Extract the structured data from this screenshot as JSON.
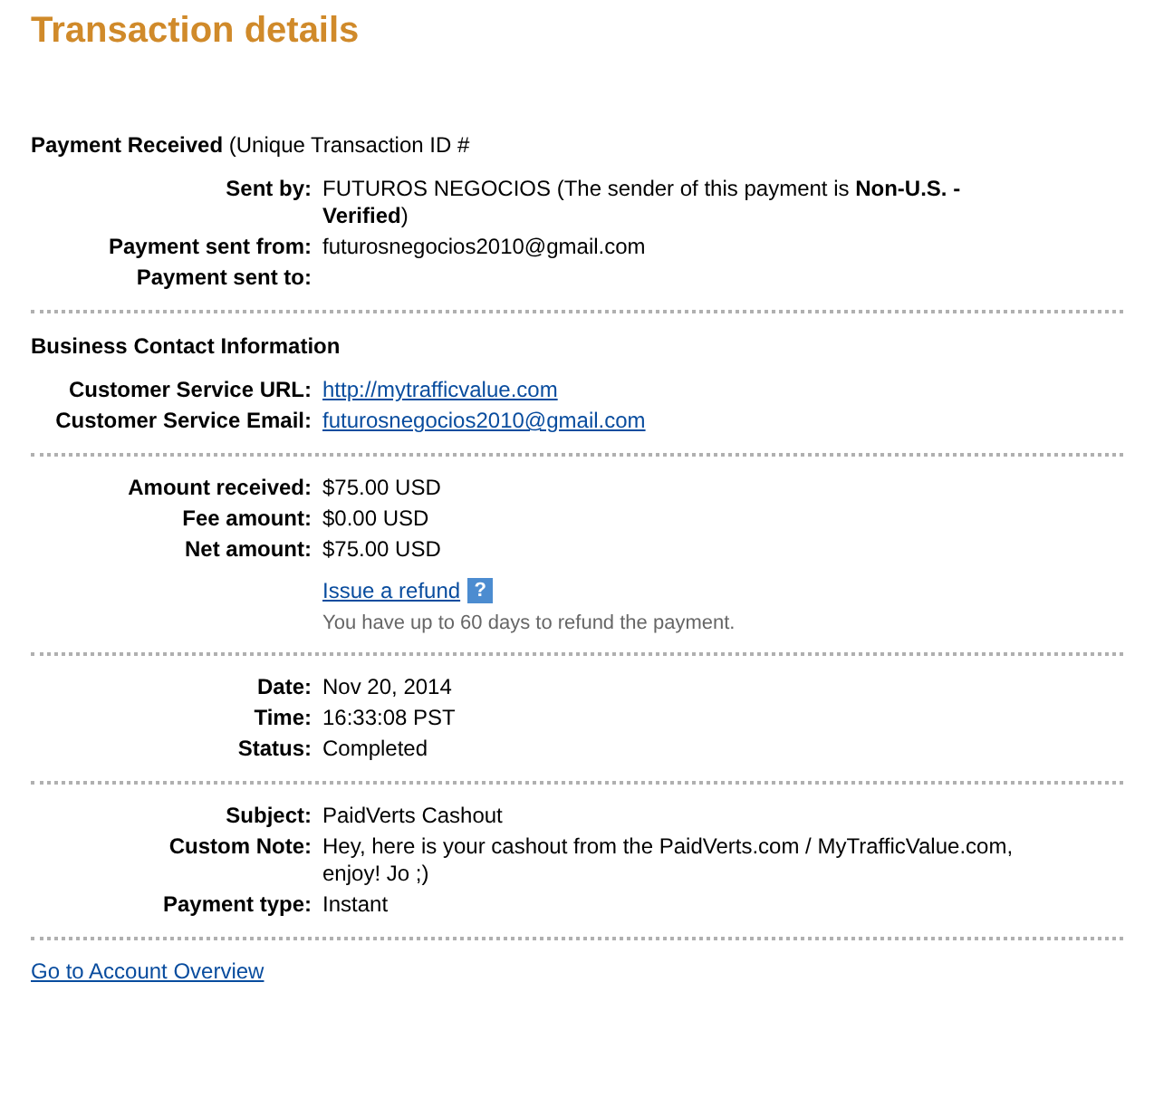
{
  "title": "Transaction details",
  "sections": [
    {
      "heading": "**Payment Received** (Unique Transaction ID #",
      "rows": [
        {
          "label": "Sent by:",
          "kind": "text",
          "value": "FUTUROS NEGOCIOS (The sender of this payment is **Non-U.S. - Verified**)"
        },
        {
          "label": "Payment sent from:",
          "kind": "text",
          "value": "futurosnegocios2010@gmail.com"
        },
        {
          "label": "Payment sent to:",
          "kind": "blank"
        }
      ]
    },
    {
      "heading": "**Business Contact Information**",
      "rows": [
        {
          "label": "Customer Service URL:",
          "kind": "link",
          "value": "http://mytrafficvalue.com"
        },
        {
          "label": "Customer Service Email:",
          "kind": "link",
          "value": "futurosnegocios2010@gmail.com"
        }
      ]
    },
    {
      "rows": [
        {
          "label": "Amount received:",
          "kind": "text",
          "value": "$75.00 USD"
        },
        {
          "label": "Fee amount:",
          "kind": "text",
          "value": "$0.00 USD"
        },
        {
          "label": "Net amount:",
          "kind": "text",
          "value": "$75.00 USD"
        }
      ],
      "refund": {
        "link": "Issue a refund",
        "help": "?",
        "note": "You have up to 60 days to refund the payment."
      }
    },
    {
      "rows": [
        {
          "label": "Date:",
          "kind": "text",
          "value": "Nov 20, 2014"
        },
        {
          "label": "Time:",
          "kind": "text",
          "value": "16:33:08 PST"
        },
        {
          "label": "Status:",
          "kind": "text",
          "value": "Completed"
        }
      ]
    },
    {
      "rows": [
        {
          "label": "Subject:",
          "kind": "text",
          "value": "PaidVerts Cashout"
        },
        {
          "label": "Custom Note:",
          "kind": "text",
          "value": "Hey, here is your cashout from the PaidVerts.com / MyTrafficValue.com, enjoy! Jo ;)"
        },
        {
          "label": "Payment type:",
          "kind": "text",
          "value": "Instant"
        }
      ]
    }
  ],
  "footer_link": "Go to Account Overview"
}
